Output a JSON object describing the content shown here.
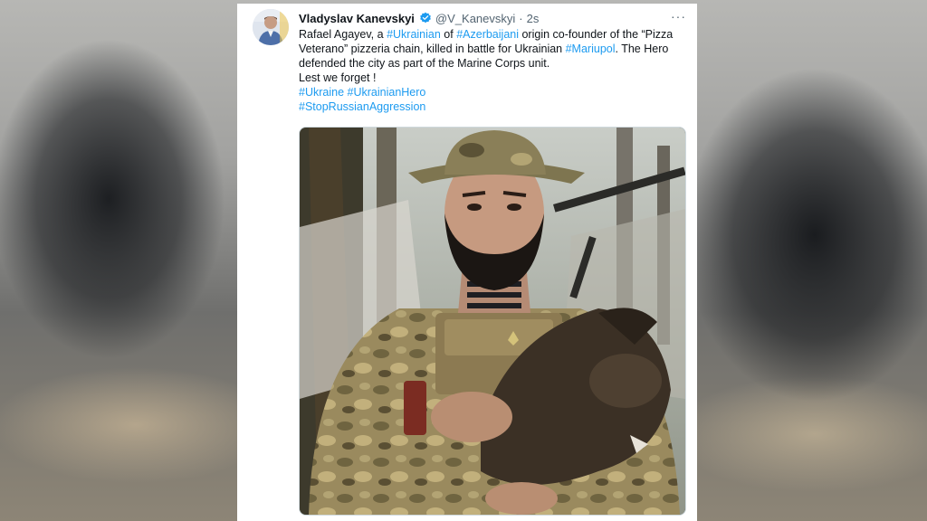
{
  "tweet": {
    "author_name": "Vladyslav Kanevskyi",
    "handle": "@V_Kanevskyi",
    "separator": "·",
    "time": "2s",
    "more_label": "···",
    "line1_a": "Rafael Agayev, a ",
    "line1_ht1": "#Ukrainian",
    "line1_b": " of ",
    "line1_ht2": "#Azerbaijani",
    "line1_c": " origin co-founder of the “Pizza Veterano” pizzeria chain, killed in battle for Ukrainian ",
    "line1_ht3": "#Mariupol",
    "line1_d": ". The Hero defended the city as part of the Marine Corps unit.",
    "line2": "Lest we forget !",
    "ht_ukraine": "#Ukraine",
    "ht_hero": "#UkrainianHero",
    "ht_stop": "#StopRussianAggression",
    "photo_icon": "soldier-holding-dog-photo"
  },
  "colors": {
    "link": "#1d9bf0",
    "text": "#0f1419",
    "muted": "#536471"
  }
}
